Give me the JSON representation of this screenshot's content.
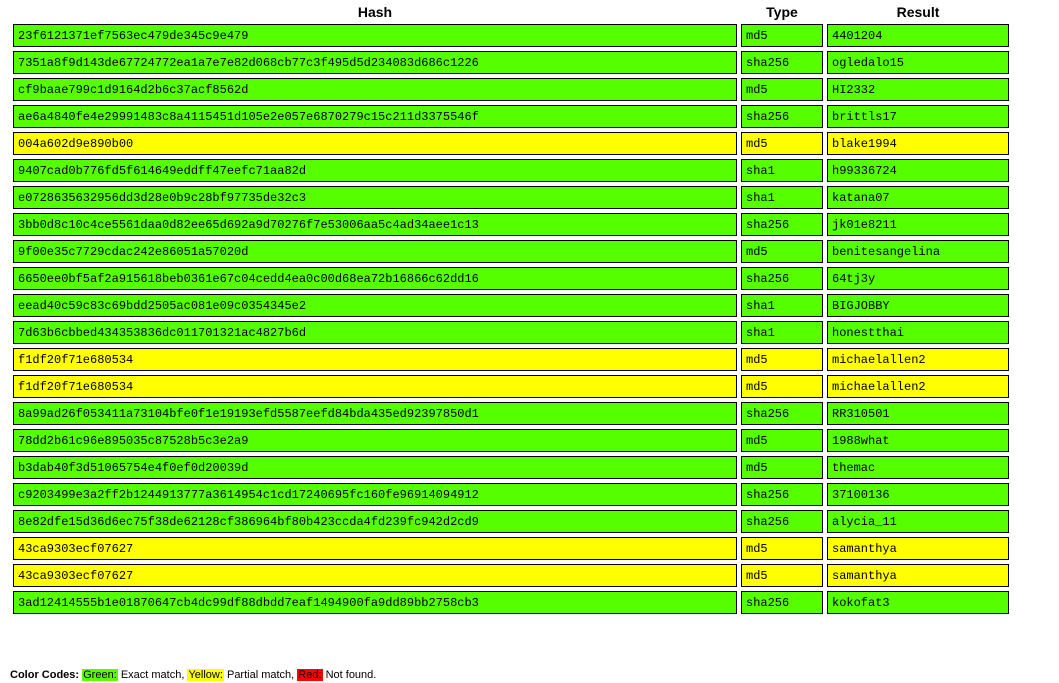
{
  "table": {
    "headers": {
      "hash": "Hash",
      "type": "Type",
      "result": "Result"
    },
    "rows": [
      {
        "hash": "23f6121371ef7563ec479de345c9e479",
        "type": "md5",
        "result": "4401204",
        "status": "green"
      },
      {
        "hash": "7351a8f9d143de67724772ea1a7e7e82d068cb77c3f495d5d234083d686c1226",
        "type": "sha256",
        "result": "ogledalo15",
        "status": "green"
      },
      {
        "hash": "cf9baae799c1d9164d2b6c37acf8562d",
        "type": "md5",
        "result": "HI2332",
        "status": "green"
      },
      {
        "hash": "ae6a4840fe4e29991483c8a4115451d105e2e057e6870279c15c211d3375546f",
        "type": "sha256",
        "result": "brittls17",
        "status": "green"
      },
      {
        "hash": "004a602d9e890b00",
        "type": "md5",
        "result": "blake1994",
        "status": "yellow"
      },
      {
        "hash": "9407cad0b776fd5f614649eddff47eefc71aa82d",
        "type": "sha1",
        "result": "h99336724",
        "status": "green"
      },
      {
        "hash": "e0728635632956dd3d28e0b9c28bf97735de32c3",
        "type": "sha1",
        "result": "katana07",
        "status": "green"
      },
      {
        "hash": "3bb0d8c10c4ce5561daa0d82ee65d692a9d70276f7e53006aa5c4ad34aee1c13",
        "type": "sha256",
        "result": "jk01e8211",
        "status": "green"
      },
      {
        "hash": "9f00e35c7729cdac242e86051a57020d",
        "type": "md5",
        "result": "benitesangelina",
        "status": "green"
      },
      {
        "hash": "6650ee0bf5af2a915618beb0361e67c04cedd4ea0c00d68ea72b16866c62dd16",
        "type": "sha256",
        "result": "64tj3y",
        "status": "green"
      },
      {
        "hash": "eead40c59c83c69bdd2505ac081e09c0354345e2",
        "type": "sha1",
        "result": "BIGJOBBY",
        "status": "green"
      },
      {
        "hash": "7d63b6cbbed434353836dc011701321ac4827b6d",
        "type": "sha1",
        "result": "honestthai",
        "status": "green"
      },
      {
        "hash": "f1df20f71e680534",
        "type": "md5",
        "result": "michaelallen2",
        "status": "yellow"
      },
      {
        "hash": "f1df20f71e680534",
        "type": "md5",
        "result": "michaelallen2",
        "status": "yellow"
      },
      {
        "hash": "8a99ad26f053411a73104bfe0f1e19193efd5587eefd84bda435ed92397850d1",
        "type": "sha256",
        "result": "RR310501",
        "status": "green"
      },
      {
        "hash": "78dd2b61c96e895035c87528b5c3e2a9",
        "type": "md5",
        "result": "1988what",
        "status": "green"
      },
      {
        "hash": "b3dab40f3d51065754e4f0ef0d20039d",
        "type": "md5",
        "result": "themac",
        "status": "green"
      },
      {
        "hash": "c9203499e3a2ff2b1244913777a3614954c1cd17240695fc160fe96914094912",
        "type": "sha256",
        "result": "37100136",
        "status": "green"
      },
      {
        "hash": "8e82dfe15d36d6ec75f38de62128cf386964bf80b423ccda4fd239fc942d2cd9",
        "type": "sha256",
        "result": "alycia_11",
        "status": "green"
      },
      {
        "hash": "43ca9303ecf07627",
        "type": "md5",
        "result": "samanthya",
        "status": "yellow"
      },
      {
        "hash": "43ca9303ecf07627",
        "type": "md5",
        "result": "samanthya",
        "status": "yellow"
      },
      {
        "hash": "3ad12414555b1e01870647cb4dc99df88dbdd7eaf1494900fa9dd89bb2758cb3",
        "type": "sha256",
        "result": "kokofat3",
        "status": "green"
      }
    ]
  },
  "legend": {
    "title": "Color Codes:",
    "green_label": "Green:",
    "green_text": " Exact match, ",
    "yellow_label": "Yellow:",
    "yellow_text": " Partial match, ",
    "red_label": "Red:",
    "red_text": " Not found."
  },
  "colors": {
    "green": "#55ff00",
    "yellow": "#ffff00",
    "red": "#ff0000"
  }
}
